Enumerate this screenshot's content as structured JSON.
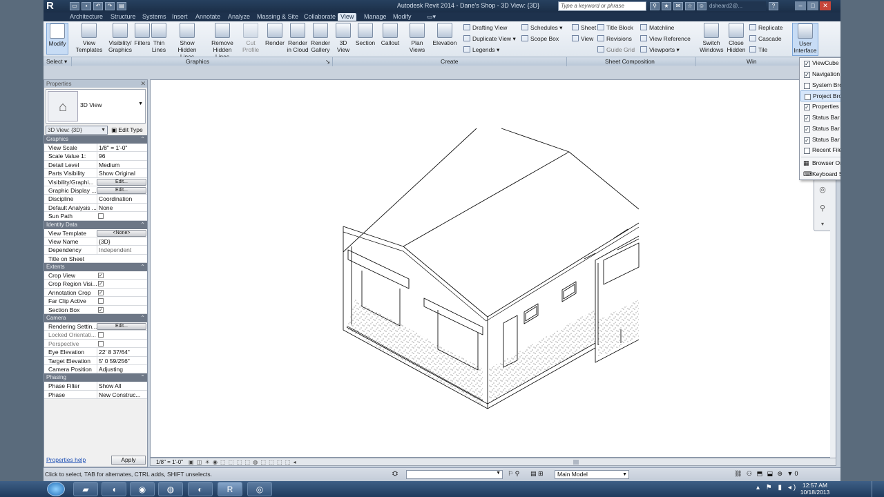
{
  "titlebar": {
    "title": "Autodesk Revit 2014 -     Dane's Shop - 3D View: {3D}",
    "search_placeholder": "Type a keyword or phrase",
    "user": "dsheard2@..."
  },
  "menu_tabs": [
    "Architecture",
    "Structure",
    "Systems",
    "Insert",
    "Annotate",
    "Analyze",
    "Massing & Site",
    "Collaborate",
    "View",
    "Manage",
    "Modify"
  ],
  "active_tab": "View",
  "ribbon": {
    "modify": "Modify",
    "select": "Select",
    "graphics": [
      {
        "label1": "View",
        "label2": "Templates"
      },
      {
        "label1": "Visibility/",
        "label2": "Graphics"
      },
      {
        "label1": "Filters",
        "label2": ""
      },
      {
        "label1": "Thin",
        "label2": "Lines"
      },
      {
        "label1": "Show",
        "label2": "Hidden Lines"
      },
      {
        "label1": "Remove",
        "label2": "Hidden Lines"
      },
      {
        "label1": "Cut",
        "label2": "Profile"
      }
    ],
    "render": [
      {
        "label1": "Render",
        "label2": ""
      },
      {
        "label1": "Render",
        "label2": "in Cloud"
      },
      {
        "label1": "Render",
        "label2": "Gallery"
      }
    ],
    "create": [
      {
        "label1": "3D",
        "label2": "View"
      },
      {
        "label1": "Section",
        "label2": ""
      },
      {
        "label1": "Callout",
        "label2": ""
      },
      {
        "label1": "Plan",
        "label2": "Views"
      },
      {
        "label1": "Elevation",
        "label2": ""
      }
    ],
    "create_small": [
      "Drafting View",
      "Duplicate View",
      "Legends",
      "Schedules",
      "Scope Box"
    ],
    "sheet_small": [
      "Sheet",
      "Title Block",
      "Matchline",
      "View",
      "Revisions",
      "View Reference",
      "Guide Grid",
      "Viewports"
    ],
    "windows": [
      {
        "label1": "Switch",
        "label2": "Windows"
      },
      {
        "label1": "Close",
        "label2": "Hidden"
      }
    ],
    "windows_small": [
      "Replicate",
      "Cascade",
      "Tile"
    ],
    "ui_button": {
      "label1": "User",
      "label2": "Interface"
    },
    "panels": [
      "Select",
      "Graphics",
      "Create",
      "Sheet Composition",
      "Win"
    ]
  },
  "properties": {
    "title": "Properties",
    "type_name": "3D View",
    "view_filter": "3D View: {3D}",
    "edit_type": "Edit Type",
    "groups": [
      {
        "name": "Graphics",
        "rows": [
          {
            "k": "View Scale",
            "v": "1/8\" = 1'-0\""
          },
          {
            "k": "Scale Value    1:",
            "v": "96"
          },
          {
            "k": "Detail Level",
            "v": "Medium"
          },
          {
            "k": "Parts Visibility",
            "v": "Show Original"
          },
          {
            "k": "Visibility/Graphi...",
            "v": "Edit..."
          },
          {
            "k": "Graphic Display ...",
            "v": "Edit..."
          },
          {
            "k": "Discipline",
            "v": "Coordination"
          },
          {
            "k": "Default Analysis ...",
            "v": "None"
          },
          {
            "k": "Sun Path",
            "v": ""
          }
        ]
      },
      {
        "name": "Identity Data",
        "rows": [
          {
            "k": "View Template",
            "v": "<None>"
          },
          {
            "k": "View Name",
            "v": "{3D}"
          },
          {
            "k": "Dependency",
            "v": "Independent"
          },
          {
            "k": "Title on Sheet",
            "v": ""
          }
        ]
      },
      {
        "name": "Extents",
        "rows": [
          {
            "k": "Crop View",
            "v": ""
          },
          {
            "k": "Crop Region Visi...",
            "v": ""
          },
          {
            "k": "Annotation Crop",
            "v": ""
          },
          {
            "k": "Far Clip Active",
            "v": ""
          },
          {
            "k": "Section Box",
            "v": ""
          }
        ]
      },
      {
        "name": "Camera",
        "rows": [
          {
            "k": "Rendering Settin...",
            "v": "Edit..."
          },
          {
            "k": "Locked Orientati...",
            "v": ""
          },
          {
            "k": "Perspective",
            "v": ""
          },
          {
            "k": "Eye Elevation",
            "v": "22'  8 37/64\""
          },
          {
            "k": "Target Elevation",
            "v": "5'  0 59/256\""
          },
          {
            "k": "Camera Position",
            "v": "Adjusting"
          }
        ]
      },
      {
        "name": "Phasing",
        "rows": [
          {
            "k": "Phase Filter",
            "v": "Show All"
          },
          {
            "k": "Phase",
            "v": "New Construc..."
          }
        ]
      }
    ],
    "help": "Properties help",
    "apply": "Apply"
  },
  "view_control": {
    "scale": "1/8\" = 1'-0\""
  },
  "ui_menu": [
    {
      "label": "ViewCube",
      "checked": true
    },
    {
      "label": "Navigation Bar",
      "checked": true
    },
    {
      "label": "System Browser",
      "checked": false
    },
    {
      "label": "Project Browser",
      "checked": false
    },
    {
      "label": "Properties",
      "checked": true
    },
    {
      "label": "Status Bar",
      "checked": true
    },
    {
      "label": "Status Bar - Worksets",
      "checked": true
    },
    {
      "label": "Status Bar - Design Options",
      "checked": true
    },
    {
      "label": "Recent Files",
      "checked": false
    },
    {
      "label": "Browser Organization",
      "checked": null
    },
    {
      "label": "Keyboard Shortcuts",
      "checked": null
    }
  ],
  "status": {
    "text": "Click to select, TAB for alternates, CTRL adds, SHIFT unselects.",
    "model": "Main Model"
  },
  "clock": {
    "time": "12:57 AM",
    "date": "10/18/2013"
  },
  "colors": {
    "titlebar": "#1b2e47",
    "accent": "#d6e6fa",
    "property_header": "#6d7786"
  }
}
